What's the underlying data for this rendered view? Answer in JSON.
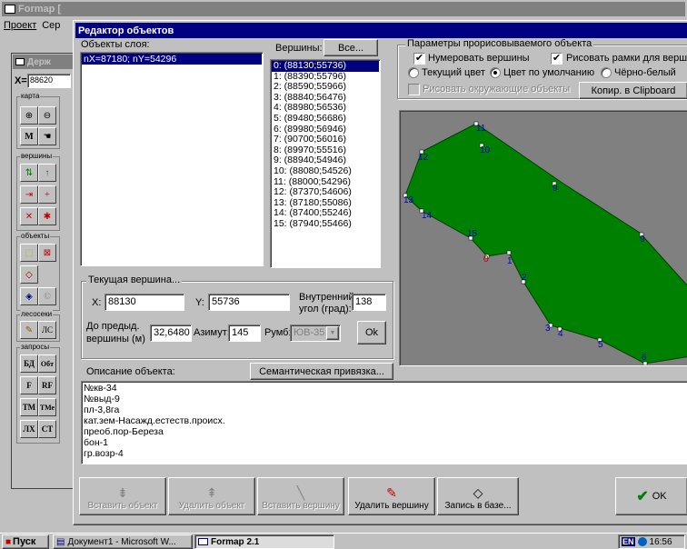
{
  "main_window": {
    "title": "Formap [",
    "menu": [
      "Проект",
      "Сер"
    ],
    "subwindow_title": "Держ",
    "x_label": "X=",
    "x_value": "88620"
  },
  "toolbox": {
    "groups": [
      {
        "label": "карта",
        "buttons": [
          "zoom-in",
          "zoom-out",
          "M",
          "hand"
        ]
      },
      {
        "label": "вершины",
        "buttons": [
          "v1",
          "v2",
          "v3",
          "v4",
          "v5",
          "v6"
        ]
      },
      {
        "label": "объекты",
        "buttons": [
          "o1",
          "o2",
          "o3",
          "o4",
          "o5"
        ]
      },
      {
        "label": "лесосеки",
        "buttons": [
          "pen",
          "ЛС"
        ]
      },
      {
        "label": "запросы",
        "buttons": [
          "БД",
          "Обт",
          "F",
          "RF",
          "ТМ",
          "ТМе",
          "ЛХ",
          "СТ"
        ]
      }
    ]
  },
  "dialog": {
    "title": "Редактор объектов",
    "layer_objects_label": "Объекты слоя:",
    "layer_objects": [
      "nX=87180; nY=54296"
    ],
    "vertices_label": "Вершины:",
    "all_button": "Все...",
    "vertices": [
      "0: (88130;55736)",
      "1: (88390;55796)",
      "2: (88590;55966)",
      "3: (88840;56476)",
      "4: (88980;56536)",
      "5: (89480;56686)",
      "6: (89980;56946)",
      "7: (90700;56016)",
      "8: (89970;55516)",
      "9: (88940;54946)",
      "10: (88080;54526)",
      "11: (88000;54296)",
      "12: (87370;54606)",
      "13: (87180;55086)",
      "14: (87400;55246)",
      "15: (87940;55466)"
    ],
    "params": {
      "title": "Параметры прорисовываемого объекта",
      "number_vertices": "Нумеровать вершины",
      "draw_frames": "Рисовать рамки для вершин",
      "current_color": "Текущий цвет",
      "default_color": "Цвет по умолчанию",
      "bw": "Чёрно-белый",
      "draw_surrounding": "Рисовать окружающие объекты",
      "copy_clipboard": "Копир. в Clipboard"
    },
    "current_vertex": {
      "title": "Текущая вершина...",
      "x_label": "X:",
      "x_value": "88130",
      "y_label": "Y:",
      "y_value": "55736",
      "inner_angle_label_1": "Внутренний",
      "inner_angle_label_2": "угол (град):",
      "inner_angle_value": "138",
      "prev_label_1": "До предыд.",
      "prev_label_2": "вершины (м)",
      "prev_value": "32,6480",
      "azimuth_label": "Азимут:",
      "azimuth_value": "145",
      "rumb_label": "Румб:",
      "rumb_value": "ЮВ-35",
      "ok": "Ok"
    },
    "description_label": "Описание объекта:",
    "semantic_button": "Семантическая привязка...",
    "description_lines": [
      "№кв-34",
      "№выд-9",
      "пл-3,8га",
      "кат.зем-Насажд.естеств.происх.",
      "преоб.пор-Береза",
      "бон-1",
      "гр.возр-4"
    ],
    "bottom_buttons": [
      {
        "label": "Вставить объект",
        "enabled": false
      },
      {
        "label": "Удалить объект",
        "enabled": false
      },
      {
        "label": "Вставить вершину",
        "enabled": false
      },
      {
        "label": "Удалить вершину",
        "enabled": true
      },
      {
        "label": "Запись в базе...",
        "enabled": true
      }
    ],
    "ok_button": "OK",
    "polygon_labels": [
      "0",
      "1",
      "2",
      "3",
      "4",
      "5",
      "6",
      "9",
      "10",
      "11",
      "12",
      "13",
      "14",
      "15"
    ],
    "colors": {
      "title": "#000080",
      "polygon": "#008000",
      "preview_bg": "#808080",
      "label": "#0000c0"
    }
  },
  "taskbar": {
    "start": "Пуск",
    "items": [
      "Документ1 - Microsoft W...",
      "Formap 2.1"
    ],
    "lang": "EN",
    "time": "16:56"
  }
}
